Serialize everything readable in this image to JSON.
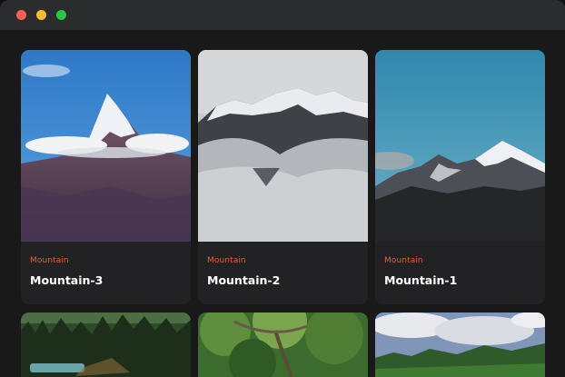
{
  "window": {
    "controls": [
      "close",
      "minimize",
      "maximize"
    ]
  },
  "cards": [
    {
      "category": "Mountain",
      "title": "Mountain-3",
      "image": "snowy-peak-blue-sky"
    },
    {
      "category": "Mountain",
      "title": "Mountain-2",
      "image": "misty-mountain-ridge"
    },
    {
      "category": "Mountain",
      "title": "Mountain-1",
      "image": "snow-ridge-teal-sky"
    },
    {
      "image": "pine-forest-lake"
    },
    {
      "image": "green-tree-canopy"
    },
    {
      "image": "cloudy-sky-treeline"
    }
  ],
  "colors": {
    "background": "#19191a",
    "card": "#222224",
    "accent": "#e35f35",
    "titlebar": "#2b2c2e"
  }
}
